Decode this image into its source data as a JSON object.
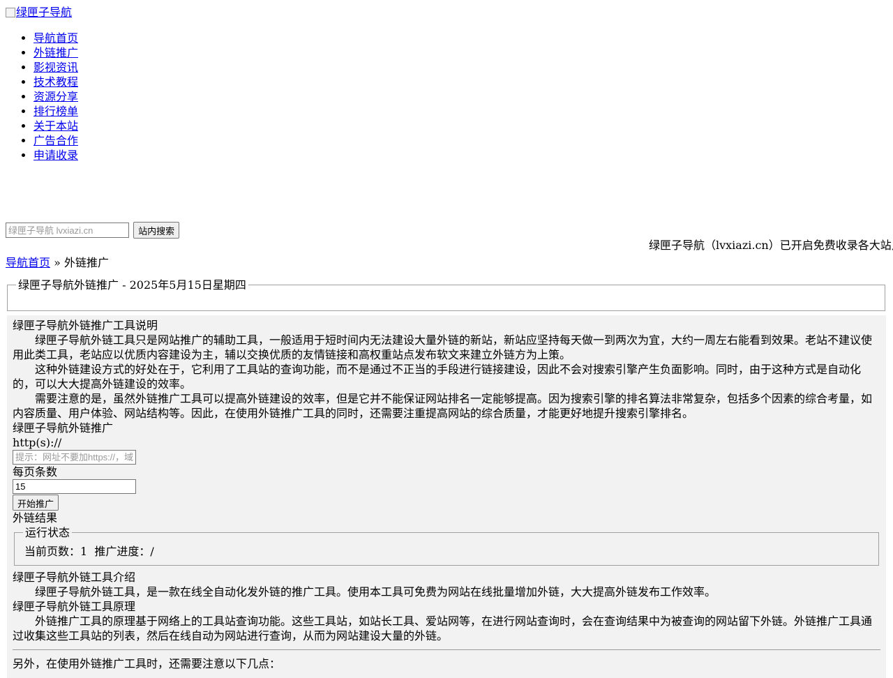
{
  "logo": {
    "alt": "绿匣子导航"
  },
  "nav": [
    "导航首页",
    "外链推广",
    "影视资讯",
    "技术教程",
    "资源分享",
    "排行榜单",
    "关于本站",
    "广告合作",
    "申请收录"
  ],
  "search": {
    "placeholder": "绿匣子导航 lvxiazi.cn",
    "button": "站内搜索"
  },
  "notice": "绿匣子导航（lvxiazi.cn）已开启免费收录各大站点",
  "breadcrumb": {
    "home": "导航首页",
    "sep": "»",
    "current": "外链推广"
  },
  "title_legend": "绿匣子导航外链推广 - 2025年5月15日星期四",
  "intro": {
    "heading": "绿匣子导航外链推广工具说明",
    "paragraphs": [
      "绿匣子导航外链工具只是网站推广的辅助工具，一般适用于短时间内无法建设大量外链的新站，新站应坚持每天做一到两次为宜，大约一周左右能看到效果。老站不建议使用此类工具，老站应以优质内容建设为主，辅以交换优质的友情链接和高权重站点发布软文来建立外链方为上策。",
      "这种外链建设方式的好处在于，它利用了工具站的查询功能，而不是通过不正当的手段进行链接建设，因此不会对搜索引擎产生负面影响。同时，由于这种方式是自动化的，可以大大提高外链建设的效率。",
      "需要注意的是，虽然外链推广工具可以提高外链建设的效率，但是它并不能保证网站排名一定能够提高。因为搜索引擎的排名算法非常复杂，包括多个因素的综合考量，如内容质量、用户体验、网站结构等。因此，在使用外链推广工具的同时，还需要注重提高网站的综合质量，才能更好地提升搜索引擎排名。"
    ]
  },
  "form": {
    "heading": "绿匣子导航外链推广",
    "url_label": "http(s)://",
    "url_placeholder": "提示：网址不要加https://，域名",
    "per_page_label": "每页条数",
    "per_page_value": "15",
    "start_button": "开始推广"
  },
  "result": {
    "heading": "外链结果",
    "legend": "运行状态",
    "current_page_label": "当前页数：",
    "current_page": "1",
    "progress_label": "推广进度：",
    "progress": "/"
  },
  "tool_intro": {
    "heading": "绿匣子导航外链工具介绍",
    "text": "绿匣子导航外链工具，是一款在线全自动化发外链的推广工具。使用本工具可免费为网站在线批量增加外链，大大提高外链发布工作效率。"
  },
  "principle": {
    "heading": "绿匣子导航外链工具原理",
    "text": "外链推广工具的原理基于网络上的工具站查询功能。这些工具站，如站长工具、爱站网等，在进行网站查询时，会在查询结果中为被查询的网站留下外链。外链推广工具通过收集这些工具站的列表，然后在线自动为网站进行查询，从而为网站建设大量的外链。"
  },
  "notes_intro": "另外，在使用外链推广工具时，还需要注意以下几点："
}
